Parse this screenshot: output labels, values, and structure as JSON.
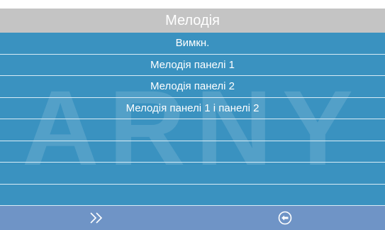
{
  "title": "Мелодія",
  "watermark": "ARNY",
  "menu": {
    "items": [
      "Вимкн.",
      "Мелодія панелі 1",
      "Мелодія панелі 2",
      "Мелодія панелі 1 і панелі 2",
      "",
      "",
      "",
      ""
    ]
  },
  "footer": {
    "icons": [
      "double-chevron-right-icon",
      "back-arrow-circle-icon"
    ]
  },
  "colors": {
    "header_bg": "#c4c4c4",
    "list_bg": "#3a92c0",
    "footer_bg": "#6f94c6",
    "text": "#ffffff"
  }
}
